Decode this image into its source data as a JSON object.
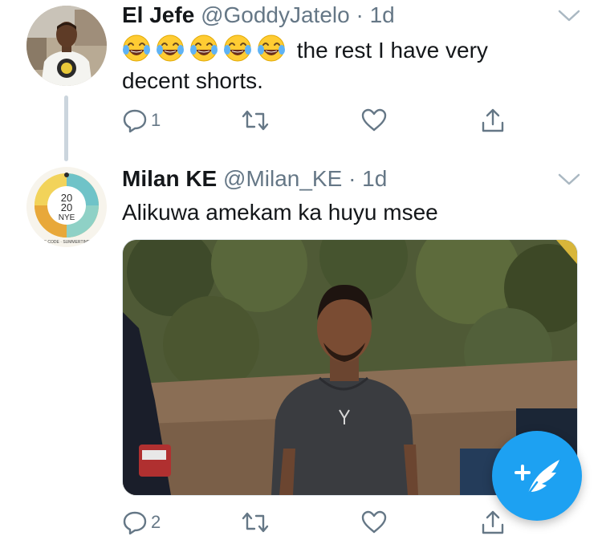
{
  "tweets": [
    {
      "name": "El Jefe",
      "handle": "@GoddyJatelo",
      "separator": "·",
      "time": "1d",
      "text_after_emoji": " the rest I have very decent shorts.",
      "emoji_count": 5,
      "emoji_icon": "face-with-tears-of-joy-icon",
      "reply_count": "1",
      "retweet_count": "",
      "like_count": ""
    },
    {
      "name": "Milan KE",
      "handle": "@Milan_KE",
      "separator": "·",
      "time": "1d",
      "text": "Alikuwa amekam ka huyu msee",
      "avatar_text": {
        "line1": "20",
        "line2": "20",
        "line3": "NYE",
        "footer": "DRESS CODE · SUMMERTIME FINE"
      },
      "reply_count": "2",
      "retweet_count": "",
      "like_count": ""
    }
  ],
  "compose_button": {
    "icon": "compose-tweet-icon"
  },
  "colors": {
    "accent": "#1da1f2",
    "secondary_text": "#657786",
    "primary_text": "#14171a",
    "thread_line": "#cbd5dd"
  }
}
